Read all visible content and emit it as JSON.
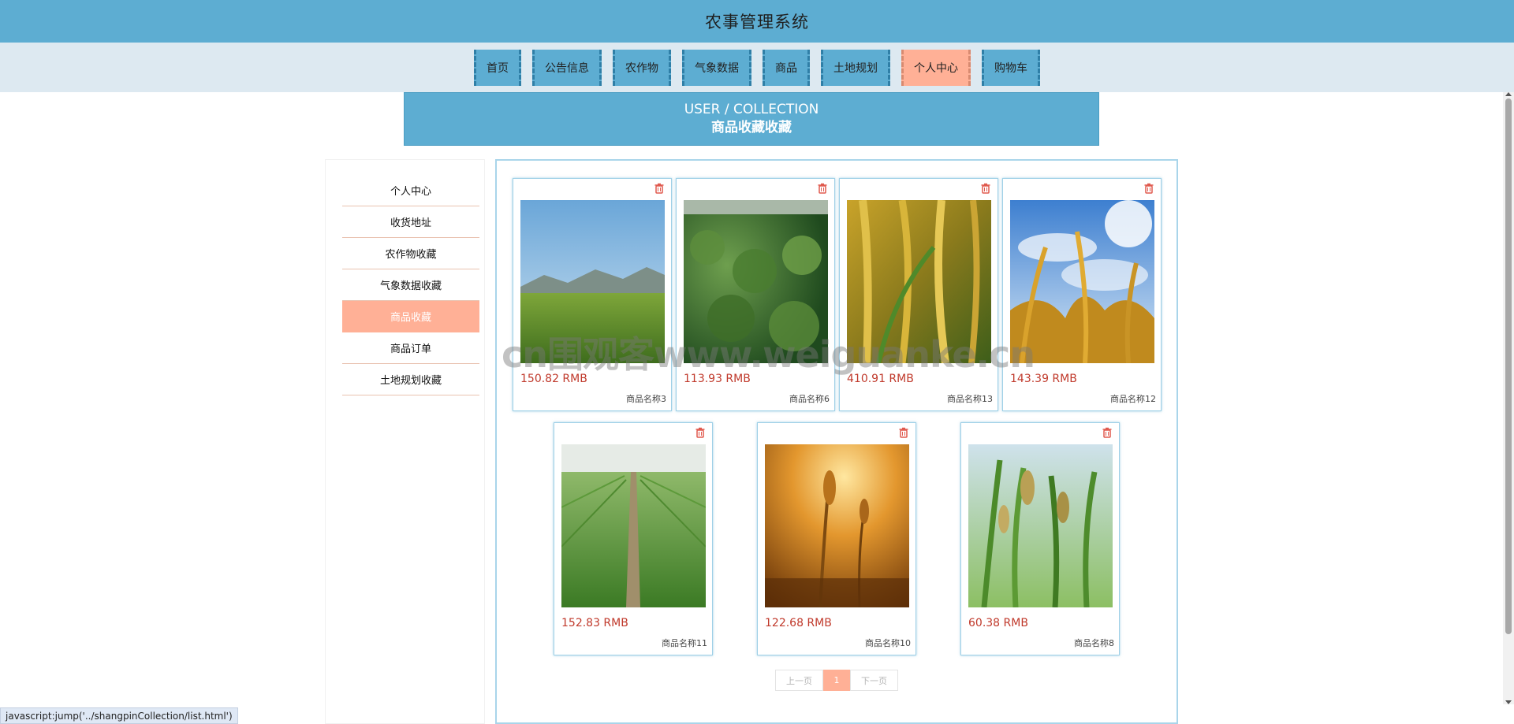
{
  "header": {
    "title": "农事管理系统"
  },
  "nav": {
    "items": [
      {
        "label": "首页",
        "name": "nav-home"
      },
      {
        "label": "公告信息",
        "name": "nav-announcements"
      },
      {
        "label": "农作物",
        "name": "nav-crops"
      },
      {
        "label": "气象数据",
        "name": "nav-weather"
      },
      {
        "label": "商品",
        "name": "nav-products"
      },
      {
        "label": "土地规划",
        "name": "nav-land-planning"
      },
      {
        "label": "个人中心",
        "name": "nav-personal-center",
        "active": true
      },
      {
        "label": "购物车",
        "name": "nav-cart"
      }
    ]
  },
  "banner": {
    "en": "USER / COLLECTION",
    "cn": "商品收藏收藏"
  },
  "sidebar": {
    "items": [
      {
        "label": "个人中心",
        "name": "sidebar-item-profile"
      },
      {
        "label": "收货地址",
        "name": "sidebar-item-address"
      },
      {
        "label": "农作物收藏",
        "name": "sidebar-item-crop-favorites"
      },
      {
        "label": "气象数据收藏",
        "name": "sidebar-item-weather-favorites"
      },
      {
        "label": "商品收藏",
        "name": "sidebar-item-product-favorites",
        "active": true
      },
      {
        "label": "商品订单",
        "name": "sidebar-item-orders"
      },
      {
        "label": "土地规划收藏",
        "name": "sidebar-item-land-favorites"
      }
    ]
  },
  "products": [
    {
      "price": "150.82 RMB",
      "name": "商品名称3",
      "image": "field-mountains"
    },
    {
      "price": "113.93 RMB",
      "name": "商品名称6",
      "image": "tea-leaves"
    },
    {
      "price": "410.91 RMB",
      "name": "商品名称13",
      "image": "rice-ears"
    },
    {
      "price": "143.39 RMB",
      "name": "商品名称12",
      "image": "wheat-sky"
    },
    {
      "price": "152.83 RMB",
      "name": "商品名称11",
      "image": "green-field-path"
    },
    {
      "price": "122.68 RMB",
      "name": "商品名称10",
      "image": "wheat-sunset"
    },
    {
      "price": "60.38 RMB",
      "name": "商品名称8",
      "image": "rice-closeup"
    }
  ],
  "pager": {
    "prev": "上一页",
    "current": "1",
    "next": "下一页"
  },
  "watermark": "cn围观客www.weiguanke.cn",
  "status": "javascript:jump('../shangpinCollection/list.html')",
  "colors": {
    "primary": "#5dadd2",
    "accent": "#ffb096",
    "price": "#c0392b"
  },
  "icons": {
    "delete": "trash-icon"
  }
}
